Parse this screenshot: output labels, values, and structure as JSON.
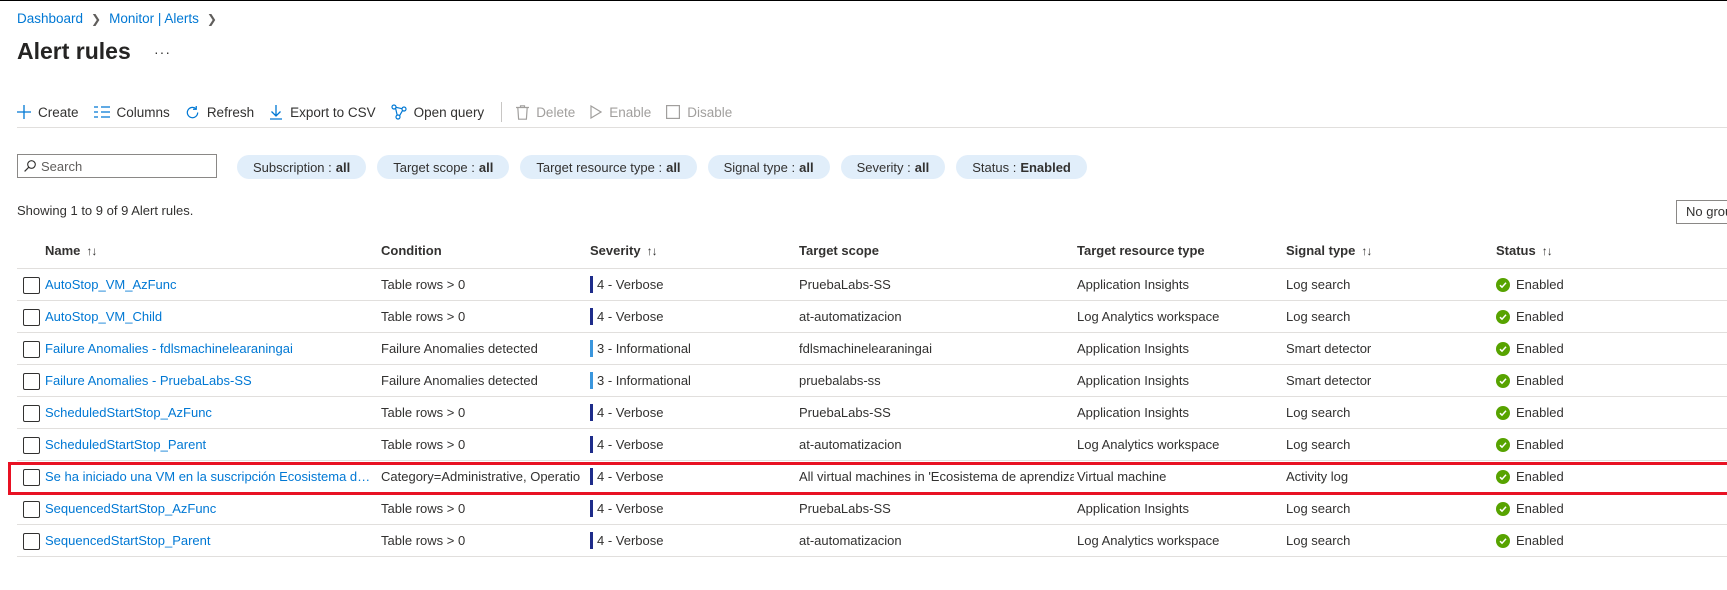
{
  "breadcrumb": {
    "item1": "Dashboard",
    "item2": "Monitor | Alerts"
  },
  "page_title": "Alert rules",
  "more_label": "···",
  "toolbar": {
    "create": "Create",
    "columns": "Columns",
    "refresh": "Refresh",
    "export": "Export to CSV",
    "open_query": "Open query",
    "delete": "Delete",
    "enable": "Enable",
    "disable": "Disable"
  },
  "search": {
    "placeholder": "Search"
  },
  "filters": [
    {
      "label": "Subscription :",
      "value": "all"
    },
    {
      "label": "Target scope :",
      "value": "all"
    },
    {
      "label": "Target resource type :",
      "value": "all"
    },
    {
      "label": "Signal type :",
      "value": "all"
    },
    {
      "label": "Severity :",
      "value": "all"
    },
    {
      "label": "Status :",
      "value": "Enabled"
    }
  ],
  "showing_text": "Showing 1 to 9 of 9 Alert rules.",
  "group_by": "No grouping",
  "columns": {
    "name": "Name",
    "condition": "Condition",
    "severity": "Severity",
    "target_scope": "Target scope",
    "target_type": "Target resource type",
    "signal_type": "Signal type",
    "status": "Status",
    "sort_glyph": "↑↓"
  },
  "colors": {
    "verbose": "#1e2c8a",
    "informational": "#3a96dd",
    "enabled": "#57a300",
    "link": "#0078d4",
    "highlight": "#e81123"
  },
  "rows": [
    {
      "name": "AutoStop_VM_AzFunc",
      "condition": "Table rows > 0",
      "severity": "4 - Verbose",
      "severity_level": "verbose",
      "target_scope": "PruebaLabs-SS",
      "target_type": "Application Insights",
      "signal_type": "Log search",
      "status": "Enabled"
    },
    {
      "name": "AutoStop_VM_Child",
      "condition": "Table rows > 0",
      "severity": "4 - Verbose",
      "severity_level": "verbose",
      "target_scope": "at-automatizacion",
      "target_type": "Log Analytics workspace",
      "signal_type": "Log search",
      "status": "Enabled"
    },
    {
      "name": "Failure Anomalies - fdlsmachinelearaningai",
      "condition": "Failure Anomalies detected",
      "severity": "3 - Informational",
      "severity_level": "informational",
      "target_scope": "fdlsmachinelearaningai",
      "target_type": "Application Insights",
      "signal_type": "Smart detector",
      "status": "Enabled"
    },
    {
      "name": "Failure Anomalies - PruebaLabs-SS",
      "condition": "Failure Anomalies detected",
      "severity": "3 - Informational",
      "severity_level": "informational",
      "target_scope": "pruebalabs-ss",
      "target_type": "Application Insights",
      "signal_type": "Smart detector",
      "status": "Enabled"
    },
    {
      "name": "ScheduledStartStop_AzFunc",
      "condition": "Table rows > 0",
      "severity": "4 - Verbose",
      "severity_level": "verbose",
      "target_scope": "PruebaLabs-SS",
      "target_type": "Application Insights",
      "signal_type": "Log search",
      "status": "Enabled"
    },
    {
      "name": "ScheduledStartStop_Parent",
      "condition": "Table rows > 0",
      "severity": "4 - Verbose",
      "severity_level": "verbose",
      "target_scope": "at-automatizacion",
      "target_type": "Log Analytics workspace",
      "signal_type": "Log search",
      "status": "Enabled"
    },
    {
      "name": "Se ha iniciado una VM en la suscripción Ecosistema de apren...",
      "condition": "Category=Administrative, Operation ...",
      "severity": "4 - Verbose",
      "severity_level": "verbose",
      "target_scope": "All virtual machines in 'Ecosistema de aprendizaje'",
      "target_type": "Virtual machine",
      "signal_type": "Activity log",
      "status": "Enabled"
    },
    {
      "name": "SequencedStartStop_AzFunc",
      "condition": "Table rows > 0",
      "severity": "4 - Verbose",
      "severity_level": "verbose",
      "target_scope": "PruebaLabs-SS",
      "target_type": "Application Insights",
      "signal_type": "Log search",
      "status": "Enabled"
    },
    {
      "name": "SequencedStartStop_Parent",
      "condition": "Table rows > 0",
      "severity": "4 - Verbose",
      "severity_level": "verbose",
      "target_scope": "at-automatizacion",
      "target_type": "Log Analytics workspace",
      "signal_type": "Log search",
      "status": "Enabled"
    }
  ]
}
